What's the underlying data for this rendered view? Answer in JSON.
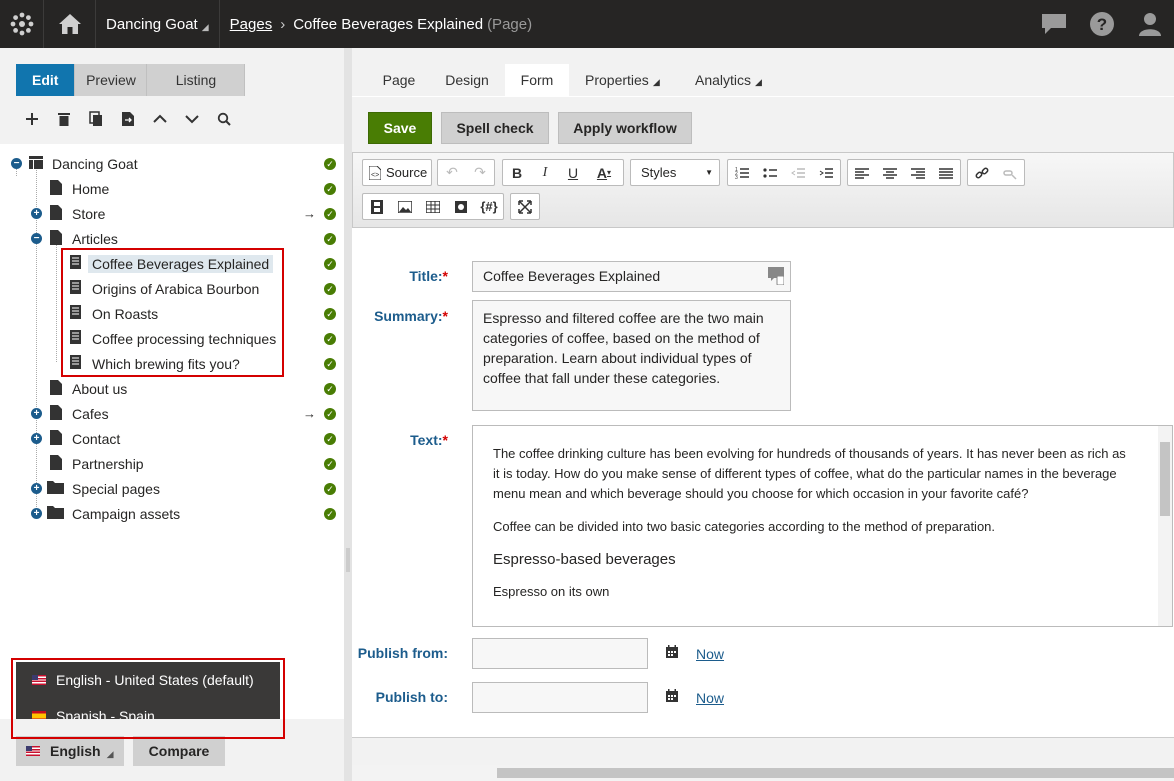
{
  "topbar": {
    "site": "Dancing Goat",
    "breadcrumb_root": "Pages",
    "breadcrumb_current": "Coffee Beverages Explained",
    "breadcrumb_type": "(Page)"
  },
  "modes": [
    "Edit",
    "Preview",
    "Listing"
  ],
  "tree": [
    {
      "label": "Dancing Goat"
    },
    {
      "label": "Home"
    },
    {
      "label": "Store",
      "arrow": "→"
    },
    {
      "label": "Articles"
    },
    {
      "label": "Coffee Beverages Explained"
    },
    {
      "label": "Origins of Arabica Bourbon"
    },
    {
      "label": "On Roasts"
    },
    {
      "label": "Coffee processing techniques"
    },
    {
      "label": "Which brewing fits you?"
    },
    {
      "label": "About us"
    },
    {
      "label": "Cafes",
      "arrow": "→"
    },
    {
      "label": "Contact"
    },
    {
      "label": "Partnership"
    },
    {
      "label": "Special pages"
    },
    {
      "label": "Campaign assets"
    }
  ],
  "languages": {
    "options": [
      "English - United States (default)",
      "Spanish - Spain"
    ],
    "selected": "English",
    "compare": "Compare"
  },
  "tabs": [
    "Page",
    "Design",
    "Form",
    "Properties",
    "Analytics"
  ],
  "actions": {
    "save": "Save",
    "spell": "Spell check",
    "workflow": "Apply workflow"
  },
  "toolbar": {
    "source": "Source",
    "styles": "Styles"
  },
  "form": {
    "title_label": "Title:",
    "title_value": "Coffee Beverages Explained",
    "summary_label": "Summary:",
    "summary_value": "Espresso and filtered coffee are the two main categories of coffee, based on the method of preparation. Learn about individual types of coffee that fall under these categories.",
    "text_label": "Text:",
    "text_p1": "The coffee drinking culture has been evolving for hundreds of thousands of years. It has never been as rich as it is today. How do you make sense of different types of coffee, what do the particular names in the beverage menu mean and which beverage should you choose for which occasion in your favorite café?",
    "text_p2": "Coffee can be divided into two basic categories according to the method of preparation.",
    "text_h": "Espresso-based beverages",
    "text_p3": "Espresso on its own",
    "publish_from_label": "Publish from:",
    "publish_to_label": "Publish to:",
    "now": "Now",
    "required": "*"
  }
}
